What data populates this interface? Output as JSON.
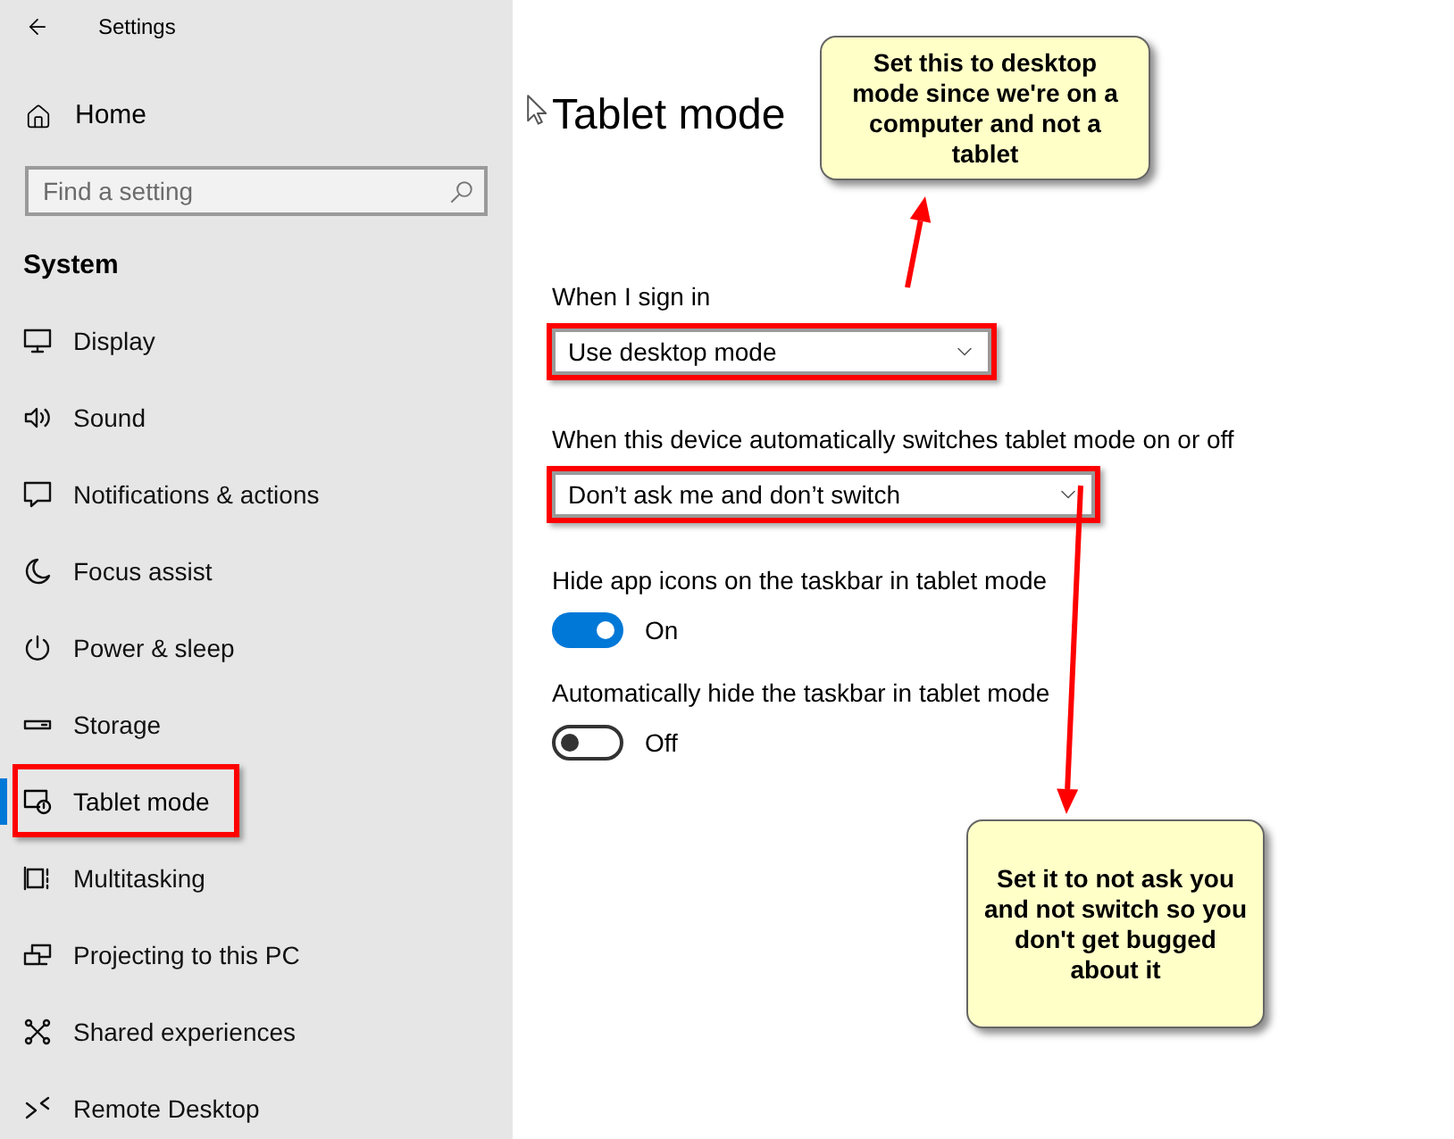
{
  "window": {
    "title": "Settings"
  },
  "sidebar": {
    "home": "Home",
    "search": {
      "placeholder": "Find a setting"
    },
    "section": "System",
    "items": [
      {
        "label": "Display",
        "selected": false,
        "annotated": false
      },
      {
        "label": "Sound",
        "selected": false,
        "annotated": false
      },
      {
        "label": "Notifications & actions",
        "selected": false,
        "annotated": false
      },
      {
        "label": "Focus assist",
        "selected": false,
        "annotated": false
      },
      {
        "label": "Power & sleep",
        "selected": false,
        "annotated": false
      },
      {
        "label": "Storage",
        "selected": false,
        "annotated": false
      },
      {
        "label": "Tablet mode",
        "selected": true,
        "annotated": true
      },
      {
        "label": "Multitasking",
        "selected": false,
        "annotated": false
      },
      {
        "label": "Projecting to this PC",
        "selected": false,
        "annotated": false
      },
      {
        "label": "Shared experiences",
        "selected": false,
        "annotated": false
      },
      {
        "label": "Remote Desktop",
        "selected": false,
        "annotated": false
      }
    ]
  },
  "page": {
    "title": "Tablet mode",
    "settings": [
      {
        "kind": "dropdown",
        "label": "When I sign in",
        "value": "Use desktop mode",
        "annotated": true
      },
      {
        "kind": "dropdown",
        "label": "When this device automatically switches tablet mode on or off",
        "value": "Don’t ask me and don’t switch",
        "annotated": true
      },
      {
        "kind": "toggle",
        "label": "Hide app icons on the taskbar in tablet mode",
        "on": true,
        "state_text": "On"
      },
      {
        "kind": "toggle",
        "label": "Automatically hide the taskbar in tablet mode",
        "on": false,
        "state_text": "Off"
      }
    ]
  },
  "callouts": [
    {
      "text": "Set this to desktop mode since we're on a computer and not a tablet"
    },
    {
      "text": "Set it to not ask you and not switch so you don't get bugged about it"
    }
  ]
}
